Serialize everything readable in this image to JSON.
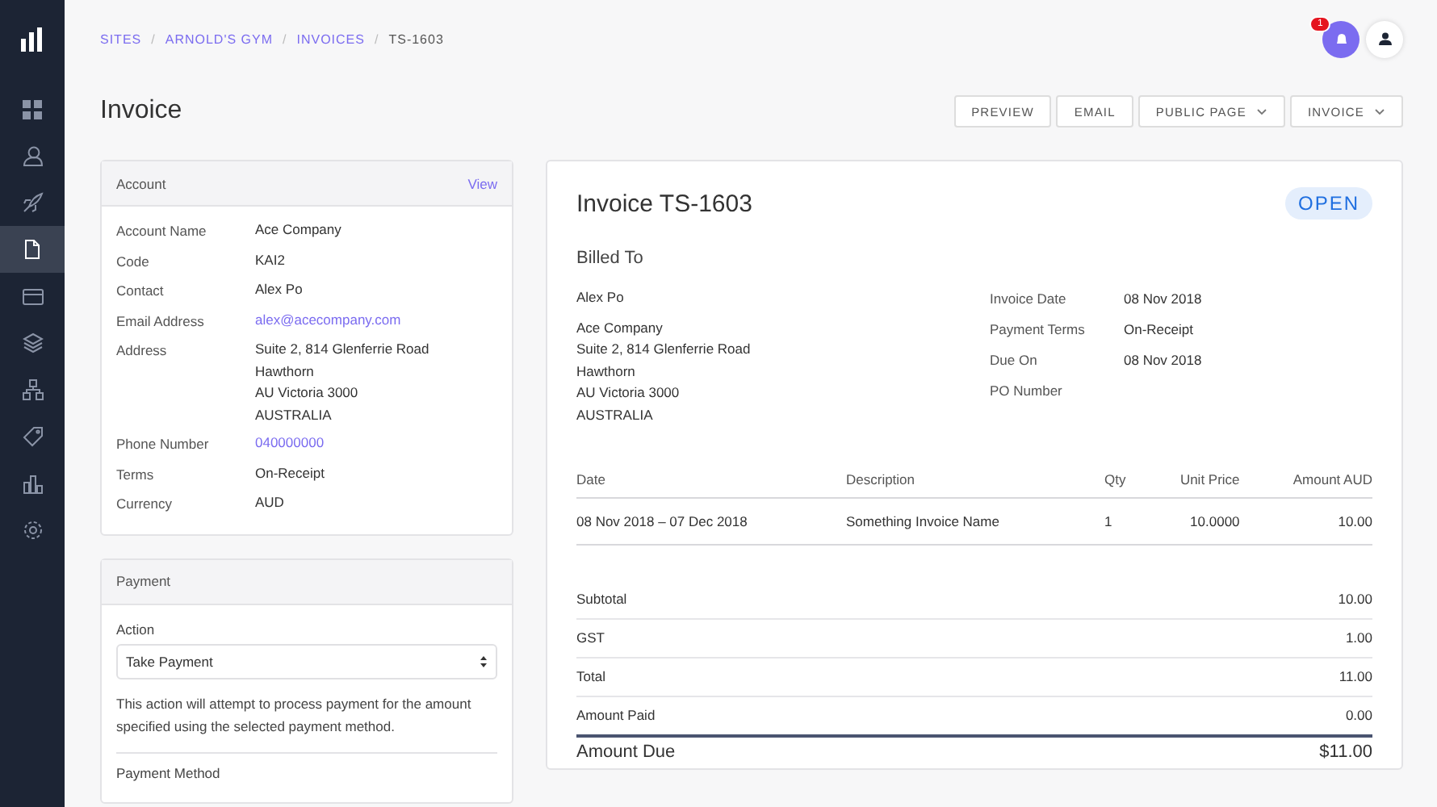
{
  "sidebar": {
    "nav": [
      {
        "kind": "dashboard",
        "selected": false
      },
      {
        "kind": "users",
        "selected": false
      },
      {
        "kind": "rocket",
        "selected": false
      },
      {
        "kind": "document",
        "selected": true
      },
      {
        "kind": "card",
        "selected": false
      },
      {
        "kind": "layers",
        "selected": false
      },
      {
        "kind": "sitemap",
        "selected": false
      },
      {
        "kind": "tag",
        "selected": false
      },
      {
        "kind": "chart",
        "selected": false
      },
      {
        "kind": "settings",
        "selected": false
      }
    ]
  },
  "breadcrumb_separator": "/",
  "breadcrumb": [
    {
      "label": "SITES",
      "current": false
    },
    {
      "label": "ARNOLD'S GYM",
      "current": false
    },
    {
      "label": "INVOICES",
      "current": false
    },
    {
      "label": "TS-1603",
      "current": true
    }
  ],
  "notifications": {
    "count": "1"
  },
  "page_title": "Invoice",
  "actions": [
    {
      "label": "PREVIEW",
      "dropdown": false
    },
    {
      "label": "EMAIL",
      "dropdown": false
    },
    {
      "label": "PUBLIC PAGE",
      "dropdown": true
    },
    {
      "label": "INVOICE",
      "dropdown": true
    }
  ],
  "account": {
    "title": "Account",
    "link": "View",
    "fields": [
      {
        "label": "Account Name",
        "kind": "text",
        "lines": [
          "Ace Company"
        ]
      },
      {
        "label": "Code",
        "kind": "text",
        "lines": [
          "KAI2"
        ]
      },
      {
        "label": "Contact",
        "kind": "text",
        "lines": [
          "Alex Po"
        ]
      },
      {
        "label": "Email Address",
        "kind": "link",
        "lines": [
          "alex@acecompany.com"
        ]
      },
      {
        "label": "Address",
        "kind": "text",
        "lines": [
          "Suite 2, 814 Glenferrie Road",
          "Hawthorn",
          "AU Victoria 3000",
          "AUSTRALIA"
        ]
      },
      {
        "label": "Phone Number",
        "kind": "link",
        "lines": [
          "040000000"
        ]
      },
      {
        "label": "Terms",
        "kind": "text",
        "lines": [
          "On-Receipt"
        ]
      },
      {
        "label": "Currency",
        "kind": "text",
        "lines": [
          "AUD"
        ]
      }
    ]
  },
  "payment": {
    "title": "Payment",
    "action_label": "Action",
    "action_value": "Take Payment",
    "help": "This action will attempt to process payment for the amount specified using the selected payment method.",
    "next_label": "Payment Method"
  },
  "invoice": {
    "title": "Invoice TS-1603",
    "status": "OPEN",
    "billed_heading": "Billed To",
    "contact": "Alex Po",
    "address": [
      "Ace Company",
      "Suite 2, 814 Glenferrie Road",
      "Hawthorn",
      "AU Victoria 3000",
      "AUSTRALIA"
    ],
    "meta": [
      {
        "label": "Invoice Date",
        "value": "08 Nov 2018"
      },
      {
        "label": "Payment Terms",
        "value": "On-Receipt"
      },
      {
        "label": "Due On",
        "value": "08 Nov 2018"
      },
      {
        "label": "PO Number"
      }
    ],
    "columns": [
      "Date",
      "Description",
      "Qty",
      "Unit Price",
      "Amount AUD"
    ],
    "rows": [
      [
        "08 Nov 2018 – 07 Dec 2018",
        "Something Invoice Name",
        "1",
        "10.0000",
        "10.00"
      ]
    ],
    "totals": [
      {
        "label": "Subtotal",
        "value": "10.00"
      },
      {
        "label": "GST",
        "value": "1.00"
      },
      {
        "label": "Total",
        "value": "11.00"
      },
      {
        "label": "Amount Paid",
        "value": "0.00"
      }
    ],
    "due": {
      "label": "Amount Due",
      "value": "$11.00"
    }
  }
}
